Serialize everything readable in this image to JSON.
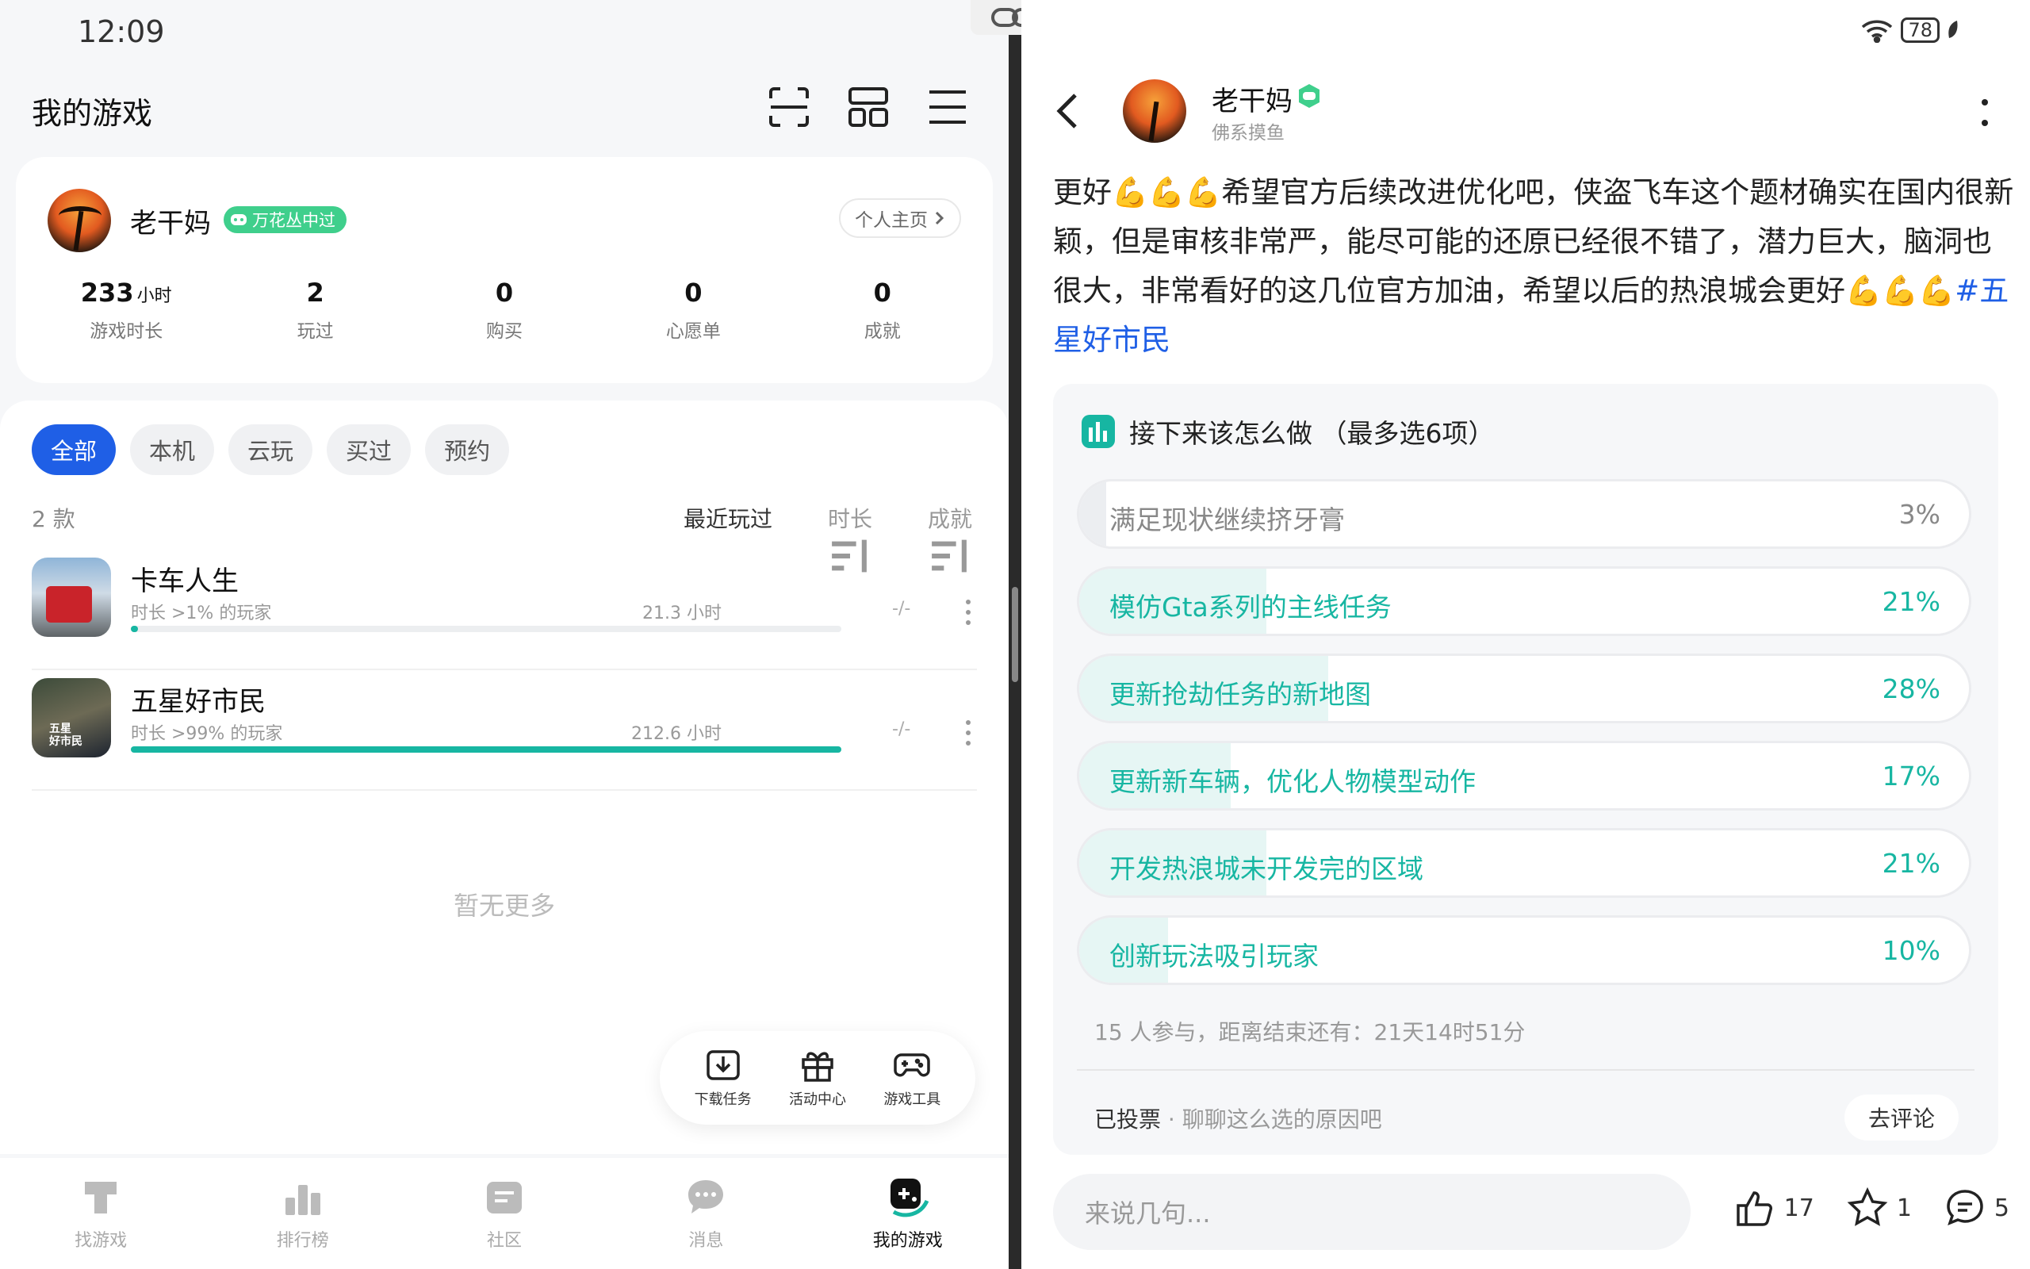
{
  "status": {
    "time": "12:09",
    "battery": "78"
  },
  "left": {
    "title": "我的游戏",
    "profile": {
      "name": "老干妈",
      "badge": "万花丛中过",
      "home_button": "个人主页",
      "stats": [
        {
          "value": "233",
          "unit": "小时",
          "label": "游戏时长"
        },
        {
          "value": "2",
          "unit": "",
          "label": "玩过"
        },
        {
          "value": "0",
          "unit": "",
          "label": "购买"
        },
        {
          "value": "0",
          "unit": "",
          "label": "心愿单"
        },
        {
          "value": "0",
          "unit": "",
          "label": "成就"
        }
      ]
    },
    "filters": [
      "全部",
      "本机",
      "云玩",
      "买过",
      "预约"
    ],
    "count": "2 款",
    "sorts": [
      "最近玩过",
      "时长",
      "成就"
    ],
    "games": [
      {
        "name": "卡车人生",
        "sub": "时长 >1% 的玩家",
        "hours": "21.3 小时",
        "achievement": "-/-",
        "progress": 0.01
      },
      {
        "name": "五星好市民",
        "sub": "时长 >99% 的玩家",
        "hours": "212.6 小时",
        "achievement": "-/-",
        "progress": 1.0
      }
    ],
    "no_more": "暂无更多",
    "quick_tools": [
      "下载任务",
      "活动中心",
      "游戏工具"
    ],
    "nav": [
      "找游戏",
      "排行榜",
      "社区",
      "消息",
      "我的游戏"
    ]
  },
  "right": {
    "author": {
      "name": "老干妈",
      "subtitle": "佛系摸鱼"
    },
    "post": {
      "text1": "更好",
      "text2": "希望官方后续改进优化吧，侠盗飞车这个题材确实在国内很新颖，但是审核非常严，能尽可能的还原已经很不错了，潜力巨大，脑洞也很大，非常看好的这几位官方加油，希望以后的热浪城会更好",
      "hashtag": "#五星好市民"
    },
    "poll": {
      "title": "接下来该怎么做 （最多选6项）",
      "options": [
        {
          "label": "满足现状继续挤牙膏",
          "pct": "3%",
          "value": 0.03,
          "highlight": false
        },
        {
          "label": "模仿Gta系列的主线任务",
          "pct": "21%",
          "value": 0.21,
          "highlight": true
        },
        {
          "label": "更新抢劫任务的新地图",
          "pct": "28%",
          "value": 0.28,
          "highlight": true
        },
        {
          "label": "更新新车辆，优化人物模型动作",
          "pct": "17%",
          "value": 0.17,
          "highlight": true
        },
        {
          "label": "开发热浪城未开发完的区域",
          "pct": "21%",
          "value": 0.21,
          "highlight": true
        },
        {
          "label": "创新玩法吸引玩家",
          "pct": "10%",
          "value": 0.1,
          "highlight": true
        }
      ],
      "meta": "15 人参与，距离结束还有：21天14时51分",
      "voted": "已投票",
      "voted_hint": "聊聊这么选的原因吧",
      "go_comment": "去评论"
    },
    "bottom": {
      "placeholder": "来说几句...",
      "likes": "17",
      "favorites": "1",
      "comments": "5"
    }
  }
}
